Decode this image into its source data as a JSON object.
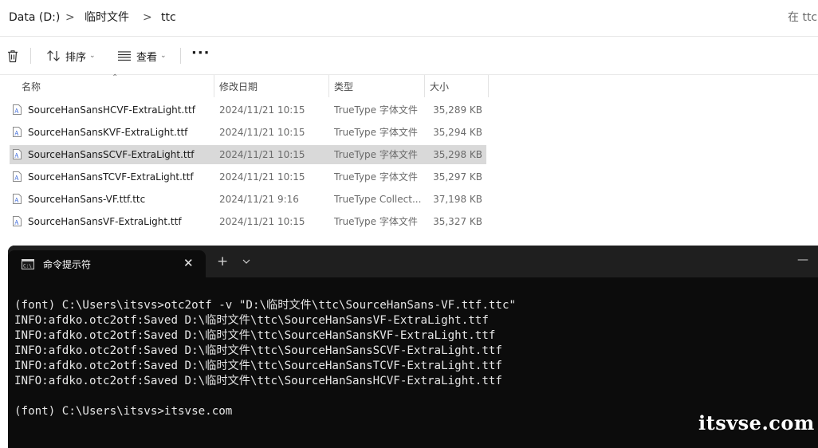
{
  "address": {
    "crumbs": [
      "Data (D:)",
      "临时文件",
      "ttc"
    ],
    "separator": ">",
    "search_hint": "在 ttc"
  },
  "toolbar": {
    "delete_icon": "trash-icon",
    "sort_label": "排序",
    "view_label": "查看",
    "more_label": "···"
  },
  "columns": {
    "name": "名称",
    "date": "修改日期",
    "type": "类型",
    "size": "大小"
  },
  "files": [
    {
      "name": "SourceHanSansHCVF-ExtraLight.ttf",
      "date": "2024/11/21 10:15",
      "type": "TrueType 字体文件",
      "size": "35,289 KB",
      "selected": false
    },
    {
      "name": "SourceHanSansKVF-ExtraLight.ttf",
      "date": "2024/11/21 10:15",
      "type": "TrueType 字体文件",
      "size": "35,294 KB",
      "selected": false
    },
    {
      "name": "SourceHanSansSCVF-ExtraLight.ttf",
      "date": "2024/11/21 10:15",
      "type": "TrueType 字体文件",
      "size": "35,298 KB",
      "selected": true
    },
    {
      "name": "SourceHanSansTCVF-ExtraLight.ttf",
      "date": "2024/11/21 10:15",
      "type": "TrueType 字体文件",
      "size": "35,297 KB",
      "selected": false
    },
    {
      "name": "SourceHanSans-VF.ttf.ttc",
      "date": "2024/11/21 9:16",
      "type": "TrueType Collect...",
      "size": "37,198 KB",
      "selected": false
    },
    {
      "name": "SourceHanSansVF-ExtraLight.ttf",
      "date": "2024/11/21 10:15",
      "type": "TrueType 字体文件",
      "size": "35,327 KB",
      "selected": false
    }
  ],
  "terminal": {
    "tab_title": "命令提示符",
    "tab_close": "✕",
    "new_tab": "+",
    "minimize": "—",
    "lines": [
      "(font) C:\\Users\\itsvs>otc2otf -v \"D:\\临时文件\\ttc\\SourceHanSans-VF.ttf.ttc\"",
      "INFO:afdko.otc2otf:Saved D:\\临时文件\\ttc\\SourceHanSansVF-ExtraLight.ttf",
      "INFO:afdko.otc2otf:Saved D:\\临时文件\\ttc\\SourceHanSansKVF-ExtraLight.ttf",
      "INFO:afdko.otc2otf:Saved D:\\临时文件\\ttc\\SourceHanSansSCVF-ExtraLight.ttf",
      "INFO:afdko.otc2otf:Saved D:\\临时文件\\ttc\\SourceHanSansTCVF-ExtraLight.ttf",
      "INFO:afdko.otc2otf:Saved D:\\临时文件\\ttc\\SourceHanSansHCVF-ExtraLight.ttf",
      "",
      "(font) C:\\Users\\itsvs>itsvse.com"
    ]
  },
  "watermark": "itsvse.com",
  "colors": {
    "selection": "#d9d9d9",
    "terminal_bg": "#0c0c0c",
    "terminal_tabbar": "#1f1f1f",
    "terminal_text": "#e6e6e6"
  }
}
